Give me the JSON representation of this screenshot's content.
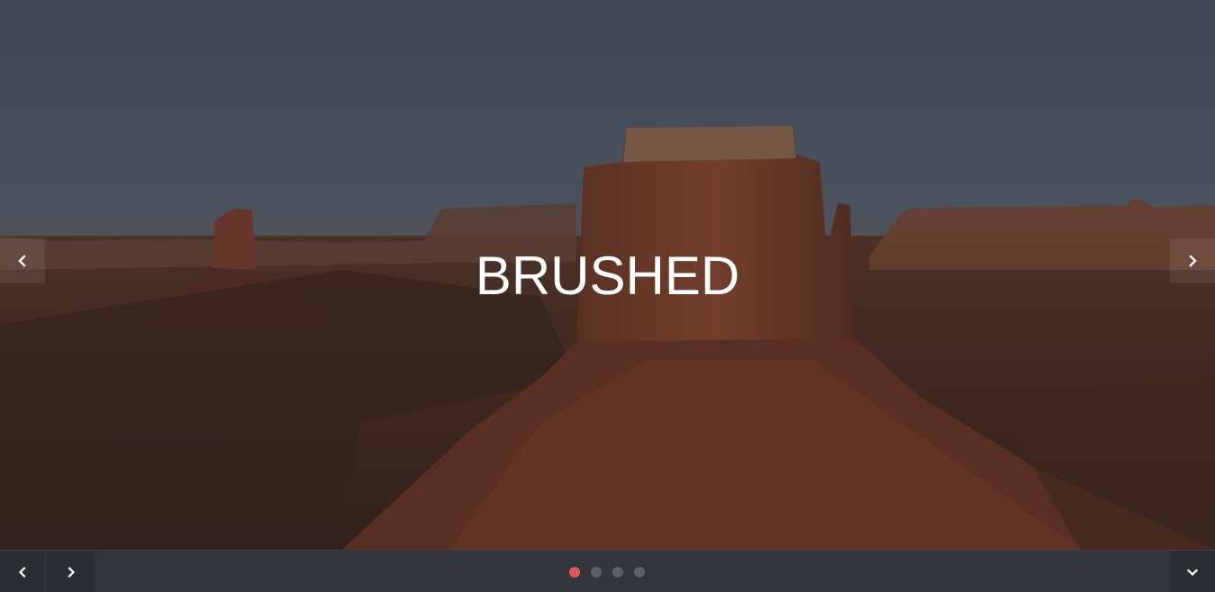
{
  "slider": {
    "title": "BRUSHED",
    "active_index": 0,
    "slide_count": 4
  },
  "icons": {
    "prev_side": "chevron-left-icon",
    "next_side": "chevron-right-icon",
    "prev_bar": "chevron-left-icon",
    "next_bar": "chevron-right-icon",
    "scroll_down": "chevron-down-icon"
  },
  "colors": {
    "active_dot": "#e0585b",
    "inactive_dot": "#5d6068",
    "bar_background": "#32353c"
  }
}
